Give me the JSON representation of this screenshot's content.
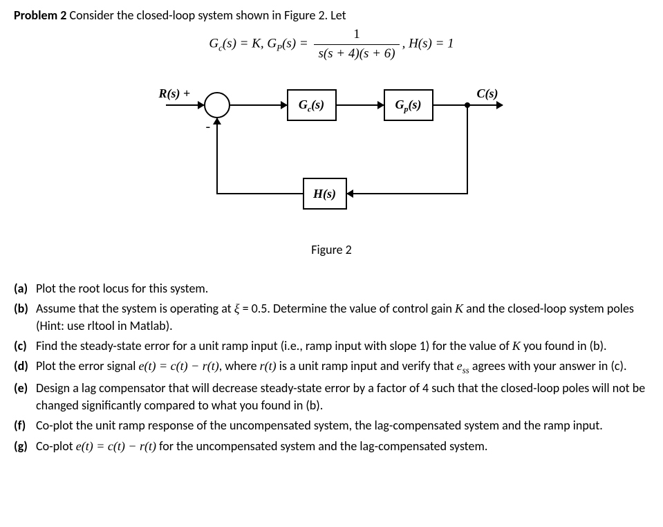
{
  "problem": {
    "label": "Problem 2",
    "intro": "Consider the closed-loop system shown in Figure 2. Let",
    "equation_prefix": "G",
    "equation_c_sub": "c",
    "equation_text1": "(s) = K, G",
    "equation_p_sub": "P",
    "equation_text2": "(s) = ",
    "frac_num": "1",
    "frac_den": "s(s + 4)(s + 6)",
    "equation_text3": ", H(s) = 1"
  },
  "diagram": {
    "r_label": "R(s)",
    "c_label": "C(s)",
    "gc_label_g": "G",
    "gc_label_sub": "c",
    "gc_label_s": "(s)",
    "gp_label_g": "G",
    "gp_label_sub": "p",
    "gp_label_s": "(s)",
    "h_label": "H(s)",
    "plus": "+",
    "minus": "-",
    "caption": "Figure 2"
  },
  "parts": {
    "a": {
      "label": "(a)",
      "text": "Plot the root locus for this system."
    },
    "b": {
      "label": "(b)",
      "text_before": "Assume that the system is operating at ",
      "xi": "ξ",
      "text_mid": " = 0.5. Determine the value of control gain ",
      "K": "K",
      "text_after": " and the closed-loop system poles (Hint: use rltool in Matlab)."
    },
    "c": {
      "label": "(c)",
      "text_before": "Find the steady-state error for a unit ramp input (i.e., ramp input with slope 1) for the value of ",
      "K": "K",
      "text_after": " you found in (b)."
    },
    "d": {
      "label": "(d)",
      "text_before": "Plot the error signal ",
      "eq1": "e(t) = c(t) − r(t)",
      "text_mid": ", where ",
      "eq2": "r(t)",
      "text_mid2": " is a unit ramp input and verify that ",
      "ess_e": "e",
      "ess_sub": "ss",
      "text_after": " agrees with your answer in (c)."
    },
    "e": {
      "label": "(e)",
      "text": "Design a lag compensator that will decrease steady-state error by a factor of 4 such that the closed-loop poles will not be changed significantly compared to what you found in (b)."
    },
    "f": {
      "label": "(f)",
      "text": "Co-plot the unit ramp response of the uncompensated system, the lag-compensated system and the ramp input."
    },
    "g": {
      "label": "(g)",
      "text_before": "Co-plot ",
      "eq": "e(t) = c(t) − r(t)",
      "text_after": " for the uncompensated system and the lag-compensated system."
    }
  }
}
